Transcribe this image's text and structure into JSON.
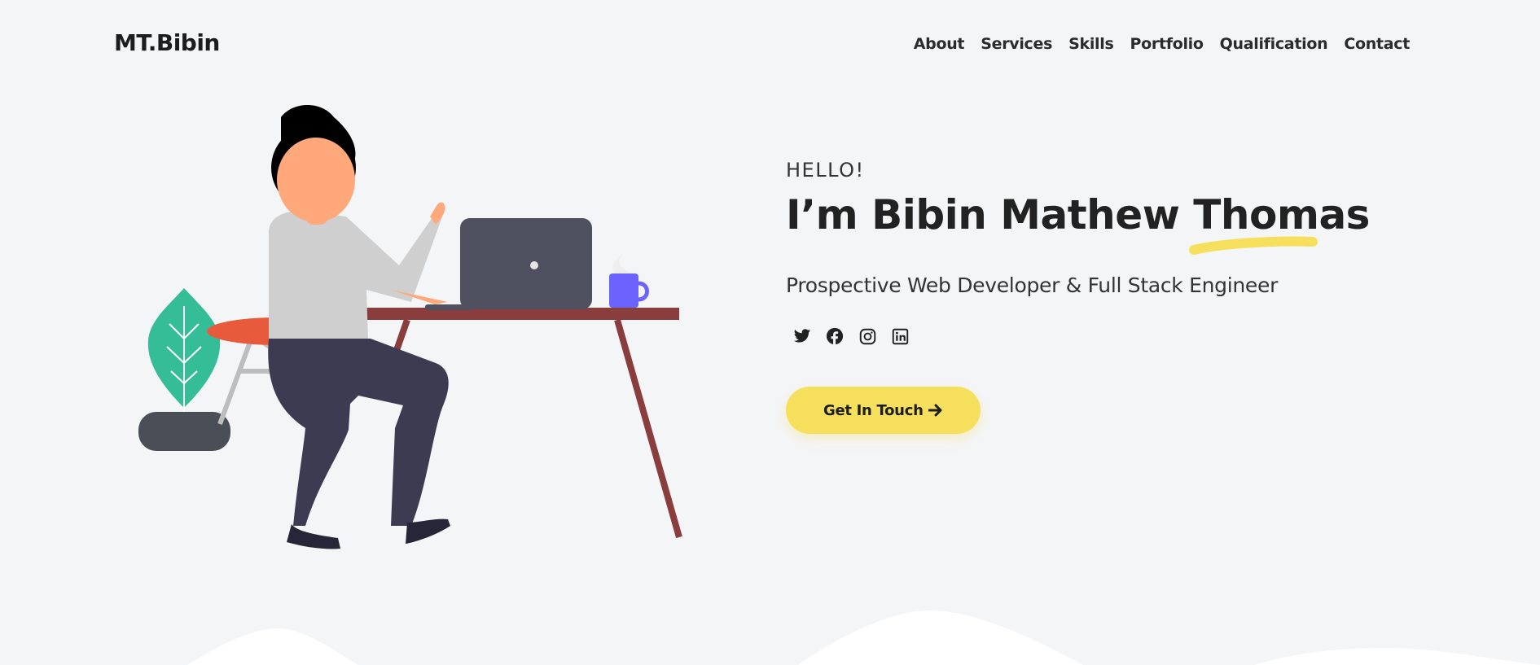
{
  "header": {
    "logo": "MT.Bibin",
    "nav": [
      "About",
      "Services",
      "Skills",
      "Portfolio",
      "Qualification",
      "Contact"
    ]
  },
  "hero": {
    "greeting": "HELLO!",
    "title": "I’m Bibin Mathew Thomas",
    "subtitle": "Prospective Web Developer & Full Stack Engineer",
    "cta_label": "Get In Touch",
    "cta_icon": "arrow-right-icon",
    "socials": [
      "twitter-icon",
      "facebook-icon",
      "instagram-icon",
      "linkedin-icon"
    ]
  },
  "colors": {
    "background": "#f4f5f7",
    "accent": "#f7df5e",
    "text": "#222222",
    "plant": "#35bd98",
    "mug": "#6c63ff",
    "desk": "#8a3d3d"
  }
}
